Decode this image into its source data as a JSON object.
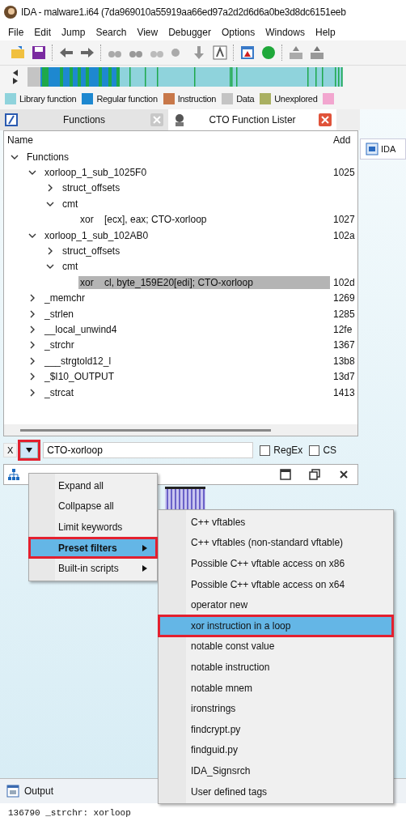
{
  "window": {
    "title": "IDA - malware1.i64 (7da969010a55919aa66ed97a2d2d6d6a0be3d8dc6151eeb"
  },
  "menu": [
    "File",
    "Edit",
    "Jump",
    "Search",
    "View",
    "Debugger",
    "Options",
    "Windows",
    "Help"
  ],
  "legend": [
    {
      "label": "Library function",
      "color": "#8fd3dc"
    },
    {
      "label": "Regular function",
      "color": "#1e88d0"
    },
    {
      "label": "Instruction",
      "color": "#c8784a"
    },
    {
      "label": "Data",
      "color": "#c4c4c4"
    },
    {
      "label": "Unexplored",
      "color": "#a9b062"
    },
    {
      "color": "#f2a6cf"
    }
  ],
  "tabs": [
    {
      "label": "Functions",
      "selected": false
    },
    {
      "label": "CTO Function Lister",
      "selected": true
    }
  ],
  "side_tab": {
    "label": "IDA"
  },
  "tree": {
    "columns": [
      "Name",
      "Add"
    ],
    "items": [
      {
        "name": "Functions",
        "expanded": true,
        "selected": false,
        "children": [
          {
            "name": "xorloop_1_sub_1025F0",
            "address": "1025",
            "expanded": true,
            "selected": false,
            "children": [
              {
                "name": "struct_offsets",
                "expanded": false,
                "selected": false
              },
              {
                "name": "cmt",
                "expanded": true,
                "selected": false,
                "children": [
                  {
                    "name": "xor    [ecx], eax; CTO-xorloop",
                    "address": "1027",
                    "selected": false
                  }
                ]
              }
            ]
          },
          {
            "name": "xorloop_1_sub_102AB0",
            "address": "102a",
            "expanded": true,
            "selected": false,
            "children": [
              {
                "name": "struct_offsets",
                "expanded": false,
                "selected": false
              },
              {
                "name": "cmt",
                "expanded": true,
                "selected": false,
                "children": [
                  {
                    "name": "xor    cl, byte_159E20[edi]; CTO-xorloop",
                    "address": "102d",
                    "selected": true
                  }
                ]
              }
            ]
          },
          {
            "name": "_memchr",
            "address": "1269",
            "expanded": false,
            "selected": false
          },
          {
            "name": "_strlen",
            "address": "1285",
            "expanded": false,
            "selected": false
          },
          {
            "name": "__local_unwind4",
            "address": "12fe",
            "expanded": false,
            "selected": false
          },
          {
            "name": "_strchr",
            "address": "1367",
            "expanded": false,
            "selected": false
          },
          {
            "name": "___strgtold12_l",
            "address": "13b8",
            "expanded": false,
            "selected": false
          },
          {
            "name": "_$I10_OUTPUT",
            "address": "13d7",
            "expanded": false,
            "selected": false
          },
          {
            "name": "_strcat",
            "address": "1413",
            "expanded": false,
            "selected": false
          }
        ]
      }
    ]
  },
  "filter": {
    "close": "X",
    "value": "CTO-xorloop",
    "menu_button_highlighted": true,
    "options": [
      {
        "label": "RegEx",
        "checked": false
      },
      {
        "label": "CS",
        "checked": false
      }
    ]
  },
  "context_menu": [
    {
      "label": "Expand all",
      "selected": false,
      "has_submenu": false,
      "highlighted": false
    },
    {
      "label": "Collpapse all",
      "selected": false,
      "has_submenu": false,
      "highlighted": false
    },
    {
      "label": "Limit keywords",
      "selected": false,
      "has_submenu": false,
      "highlighted": false
    },
    {
      "label": "Preset filters",
      "selected": true,
      "has_submenu": true,
      "highlighted": true
    },
    {
      "label": "Built-in scripts",
      "selected": false,
      "has_submenu": true,
      "highlighted": false
    }
  ],
  "submenu": [
    {
      "label": "C++ vftables",
      "selected": false,
      "highlighted": false
    },
    {
      "label": "C++ vftables (non-standard vftable)",
      "selected": false,
      "highlighted": false
    },
    {
      "label": "Possible C++ vftable access on x86",
      "selected": false,
      "highlighted": false
    },
    {
      "label": "Possible C++ vftable access on x64",
      "selected": false,
      "highlighted": false
    },
    {
      "label": "operator new",
      "selected": false,
      "highlighted": false
    },
    {
      "label": "xor instruction in a loop",
      "selected": true,
      "highlighted": true
    },
    {
      "label": "notable const value",
      "selected": false,
      "highlighted": false
    },
    {
      "label": "notable instruction",
      "selected": false,
      "highlighted": false
    },
    {
      "label": "notable mnem",
      "selected": false,
      "highlighted": false
    },
    {
      "label": "ironstrings",
      "selected": false,
      "highlighted": false
    },
    {
      "label": "findcrypt.py",
      "selected": false,
      "highlighted": false
    },
    {
      "label": "findguid.py",
      "selected": false,
      "highlighted": false
    },
    {
      "label": "IDA_Signsrch",
      "selected": false,
      "highlighted": false
    },
    {
      "label": "User defined tags",
      "selected": false,
      "highlighted": false
    }
  ],
  "output": {
    "title": "Output",
    "lines": [
      "136790 _strchr: xorloop"
    ]
  }
}
